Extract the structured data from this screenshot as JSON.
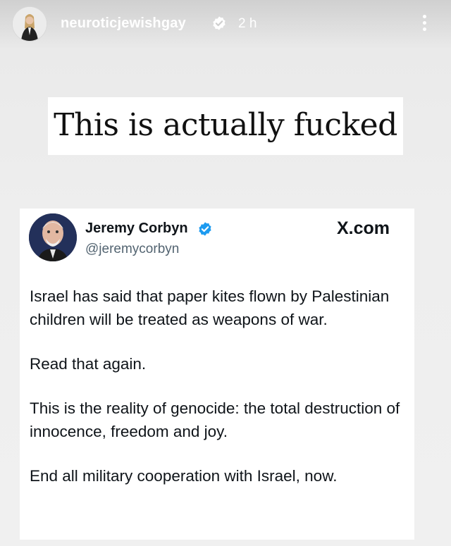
{
  "story": {
    "username": "neuroticjewishgay",
    "time_ago": "2 h",
    "headline": "This is actually fucked"
  },
  "tweet": {
    "author_name": "Jeremy Corbyn",
    "author_handle": "@jeremycorbyn",
    "source": "X.com",
    "paragraphs": [
      "Israel has said that paper kites flown by Palestinian children will be treated as weapons of war.",
      "Read that again.",
      "This is the reality of genocide: the total destruction of innocence, freedom and joy.",
      "End all military cooperation with Israel, now."
    ]
  },
  "icons": {
    "verified": "verified-badge-icon",
    "more": "more-vertical-icon",
    "verified_color": "#1d9bf0"
  }
}
